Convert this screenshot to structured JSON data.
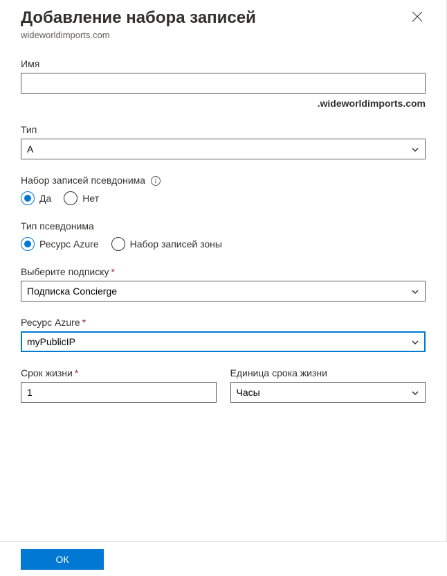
{
  "header": {
    "title": "Добавление набора записей",
    "subtitle": "wideworldimports.com"
  },
  "name_field": {
    "label": "Имя",
    "value": "",
    "suffix": ".wideworldimports.com"
  },
  "type_field": {
    "label": "Тип",
    "value": "A"
  },
  "alias_recordset": {
    "label": "Набор записей псевдонима",
    "yes": "Да",
    "no": "Нет"
  },
  "alias_type": {
    "label": "Тип псевдонима",
    "azure_resource": "Ресурс Azure",
    "zone_recordset": "Набор записей зоны"
  },
  "subscription": {
    "label": "Выберите подписку",
    "value": "Подписка Concierge"
  },
  "azure_resource": {
    "label": "Ресурс Azure",
    "value": "myPublicIP"
  },
  "ttl": {
    "label": "Срок жизни",
    "value": "1"
  },
  "ttl_unit": {
    "label": "Единица срока жизни",
    "value": "Часы"
  },
  "footer": {
    "ok": "ОК"
  }
}
